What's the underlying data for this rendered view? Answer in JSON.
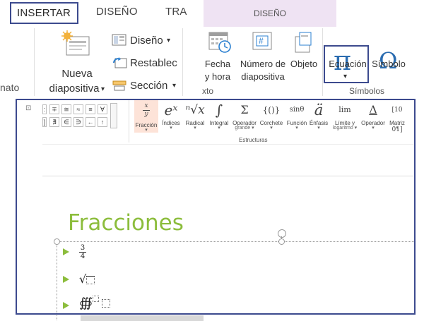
{
  "tabs": {
    "insertar": "INSERTAR",
    "diseno": "DISEÑO",
    "transiciones_partial": "TRA",
    "contextual_diseno": "DISEÑO"
  },
  "ribbon": {
    "left_partial_group": "nato",
    "nueva_diapositiva_line1": "Nueva",
    "nueva_diapositiva_line2": "diapositiva",
    "diseno_menu": "Diseño",
    "restablecer": "Restablec",
    "seccion": "Sección",
    "fecha_hora_line1": "Fecha",
    "fecha_hora_line2": "y hora",
    "numero_line1": "Número de",
    "numero_line2": "diapositiva",
    "objeto": "Objeto",
    "texto_group_partial": "xto",
    "ecuacion": "Ecuación",
    "simbolo": "Símbolo",
    "simbolos_group": "Símbolos",
    "hash_glyph": "#",
    "pi_glyph": "π",
    "omega_glyph": "Ω",
    "dropdown_glyph": "▾"
  },
  "equation_toolbar": {
    "symbol_rows": [
      [
        "∓",
        "≅",
        "≈",
        "≡",
        "∀"
      ],
      [
        "∄",
        "∈",
        "∋",
        "←",
        "↑"
      ]
    ],
    "left_row_glyphs": [
      ":",
      "]"
    ],
    "expand_glyph": "⊡",
    "structures": [
      {
        "glyph": "x/y",
        "label": "Fracción",
        "sub": "▾",
        "active": true
      },
      {
        "glyph": "eˣ",
        "label": "Índices",
        "sub": "▾"
      },
      {
        "glyph": "ⁿ√x",
        "label": "Radical",
        "sub": "▾"
      },
      {
        "glyph": "∫",
        "label": "Integral",
        "sub": "▾"
      },
      {
        "glyph": "Σ",
        "label": "Operador",
        "sub": "grande ▾"
      },
      {
        "glyph": "{()}",
        "label": "Corchete",
        "sub": "▾"
      },
      {
        "glyph": "sinθ",
        "label": "Función",
        "sub": "▾"
      },
      {
        "glyph": "ä",
        "label": "Énfasis",
        "sub": "▾"
      },
      {
        "glyph": "lim",
        "label": "Límite y",
        "sub": "logaritmo ▾"
      },
      {
        "glyph": "Δ",
        "label": "Operador",
        "sub": "▾"
      },
      {
        "glyph": "[10 01]",
        "label": "Matriz",
        "sub": "▾"
      }
    ],
    "group_label": "Estructuras"
  },
  "slide": {
    "title": "Fracciones",
    "bullets": {
      "frac_num": "3",
      "frac_den": "4",
      "sqrt": "√",
      "triple_integral": "∰"
    }
  },
  "colors": {
    "accent_frame": "#3c4a8e",
    "title_green": "#8cbd3c",
    "contextual_tab_bg": "#efe3f3",
    "active_struct_bg": "#fde3d8"
  }
}
